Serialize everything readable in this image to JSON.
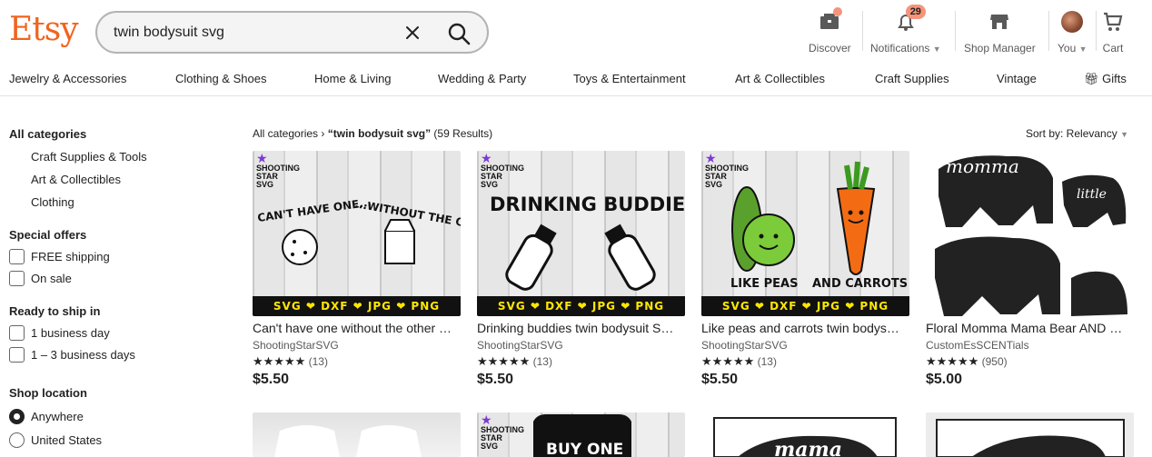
{
  "header": {
    "logo": "Etsy",
    "search_value": "twin bodysuit svg",
    "nav": [
      {
        "label": "Discover",
        "icon": "discover-icon"
      },
      {
        "label": "Notifications",
        "icon": "bell-icon",
        "badge": "29"
      },
      {
        "label": "Shop Manager",
        "icon": "shop-icon"
      },
      {
        "label": "You",
        "icon": "avatar"
      },
      {
        "label": "Cart",
        "icon": "cart-icon"
      }
    ]
  },
  "categories": [
    "Jewelry & Accessories",
    "Clothing & Shoes",
    "Home & Living",
    "Wedding & Party",
    "Toys & Entertainment",
    "Art & Collectibles",
    "Craft Supplies",
    "Vintage",
    "Gifts"
  ],
  "sidebar": {
    "all_categories": "All categories",
    "subcategories": [
      "Craft Supplies & Tools",
      "Art & Collectibles",
      "Clothing"
    ],
    "special_offers": {
      "title": "Special offers",
      "options": [
        "FREE shipping",
        "On sale"
      ]
    },
    "ready_to_ship": {
      "title": "Ready to ship in",
      "options": [
        "1 business day",
        "1 – 3 business days"
      ]
    },
    "shop_location": {
      "title": "Shop location",
      "options": [
        "Anywhere",
        "United States"
      ],
      "selected": "Anywhere"
    }
  },
  "results": {
    "crumb_root": "All categories",
    "crumb_query": "“twin bodysuit svg”",
    "count": "(59 Results)",
    "sort": "Sort by: Relevancy"
  },
  "listings": [
    {
      "title": "Can't have one without the other SVG",
      "shop": "ShootingStarSVG",
      "stars": "★★★★★",
      "reviews": "(13)",
      "price": "$5.50",
      "art_left": "CAN'T HAVE ONE...",
      "art_right": "...WITHOUT THE OTHER",
      "strip": "SVG ❤ DXF ❤ JPG ❤ PNG"
    },
    {
      "title": "Drinking buddies twin bodysuit SVG",
      "shop": "ShootingStarSVG",
      "stars": "★★★★★",
      "reviews": "(13)",
      "price": "$5.50",
      "art_left": "DRINKING BUDDIES",
      "art_right": "",
      "strip": "SVG ❤ DXF ❤ JPG ❤ PNG"
    },
    {
      "title": "Like peas and carrots twin bodysuit SVG",
      "shop": "ShootingStarSVG",
      "stars": "★★★★★",
      "reviews": "(13)",
      "price": "$5.50",
      "art_left": "LIKE PEAS",
      "art_right": "AND CARROTS",
      "strip": "SVG ❤ DXF ❤ JPG ❤ PNG"
    },
    {
      "title": "Floral Momma Mama Bear AND Little",
      "shop": "CustomEsSCENTials",
      "stars": "★★★★★",
      "reviews": "(950)",
      "price": "$5.00",
      "art_left": "momma",
      "art_right": "little",
      "strip": ""
    }
  ],
  "second_row": {
    "art_buy": "BUY ONE",
    "art_mama": "mama"
  },
  "colors": {
    "brand": "#f1641e",
    "badge": "#f5947a",
    "strip_text": "#ffe600"
  }
}
